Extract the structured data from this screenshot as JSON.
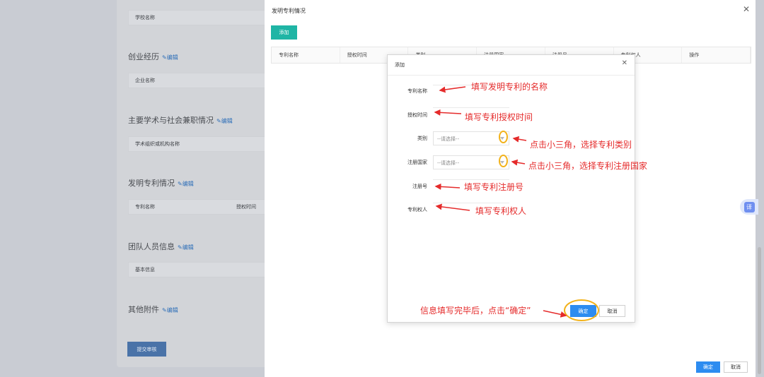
{
  "background": {
    "sections": [
      {
        "field": "学校名称"
      },
      {
        "title": "创业经历",
        "edit": "编辑",
        "field": "企业名称"
      },
      {
        "title": "主要学术与社会兼职情况",
        "edit": "编辑",
        "field": "学术组织或机构名称"
      },
      {
        "title": "发明专利情况",
        "edit": "编辑",
        "field": "专利名称",
        "field2": "授权时间"
      },
      {
        "title": "团队人员信息",
        "edit": "编辑",
        "field": "基本信息"
      },
      {
        "title": "其他附件",
        "edit": "编辑"
      }
    ],
    "submit_label": "提交审核"
  },
  "outer_dialog": {
    "title": "发明专利情况",
    "add_label": "添加",
    "columns": [
      "专利名称",
      "授权时间",
      "类别",
      "注册国家",
      "注册号",
      "专利权人",
      "操作"
    ],
    "ok_label": "确定",
    "cancel_label": "取消"
  },
  "inner_dialog": {
    "title": "添加",
    "fields": [
      {
        "label": "专利名称"
      },
      {
        "label": "授权时间"
      },
      {
        "label": "类别",
        "placeholder": "--请选择--"
      },
      {
        "label": "注册国家",
        "placeholder": "--请选择--"
      },
      {
        "label": "注册号"
      },
      {
        "label": "专利权人"
      }
    ],
    "ok_label": "确定",
    "cancel_label": "取消"
  },
  "annotations": {
    "name": "填写发明专利的名称",
    "time": "填写专利授权时间",
    "category": "点击小三角，选择专利类别",
    "country": "点击小三角，选择专利注册国家",
    "number": "填写专利注册号",
    "owner": "填写专利权人",
    "confirm": "信息填写完毕后，点击“确定”"
  },
  "translate_badge": "译",
  "colors": {
    "accent": "#2d8cf0",
    "teal": "#1fb5a5",
    "annotation": "#e52b2b",
    "highlight": "#f2b21b"
  }
}
